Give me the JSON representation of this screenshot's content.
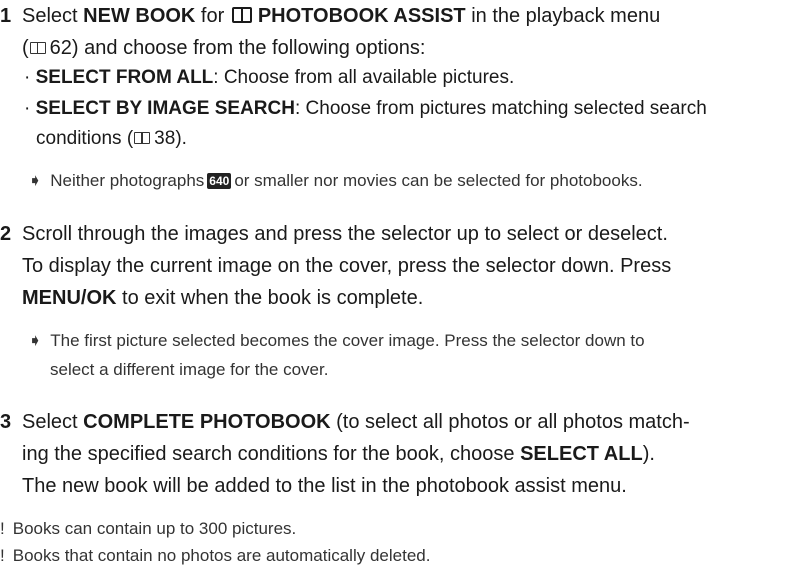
{
  "steps": [
    {
      "num": "1",
      "parts": {
        "a": "Select ",
        "b1": "NEW BOOK",
        "c": " for ",
        "b2": "PHOTOBOOK ASSIST",
        "d": " in the playback menu",
        "line2_a": "(",
        "page_ref": "62",
        "line2_b": ") and choose from the following options:"
      },
      "bullets": [
        {
          "label": "SELECT FROM ALL",
          "text": ": Choose from all available pictures."
        },
        {
          "label": "SELECT BY IMAGE SEARCH",
          "text": ": Choose from pictures matching selected search",
          "cont_a": "conditions (",
          "page_ref": "38",
          "cont_b": ")."
        }
      ],
      "note_a": "Neither photographs",
      "badge": "640",
      "note_b": "or smaller nor movies can be selected for photobooks."
    },
    {
      "num": "2",
      "line1": "Scroll through the images and press the selector up to select or deselect.",
      "line2": "To display the current image on the cover, press the selector down.  Press",
      "line3_b": "MENU/OK",
      "line3_c": " to exit when the book is complete.",
      "note_line1": "The first picture selected becomes the cover image.  Press the selector down to",
      "note_line2": "select a different image for the cover."
    },
    {
      "num": "3",
      "line1_a": "Select ",
      "line1_b": "COMPLETE PHOTOBOOK",
      "line1_c": " (to select all photos or all photos match-",
      "line2_a": "ing the specified search conditions for the book, choose ",
      "line2_b": "SELECT ALL",
      "line2_c": ").",
      "line3": "The new book will be added to the list in the photobook assist menu."
    }
  ],
  "cautions": [
    {
      "mark": "!",
      "text": "Books can contain up to 300 pictures."
    },
    {
      "mark": "!",
      "text": "Books that contain no photos are automatically deleted."
    }
  ],
  "icons": {
    "book": "photobook-icon",
    "ref": "page-reference-icon",
    "note": "note-arrow-icon",
    "caution": "caution-icon"
  }
}
